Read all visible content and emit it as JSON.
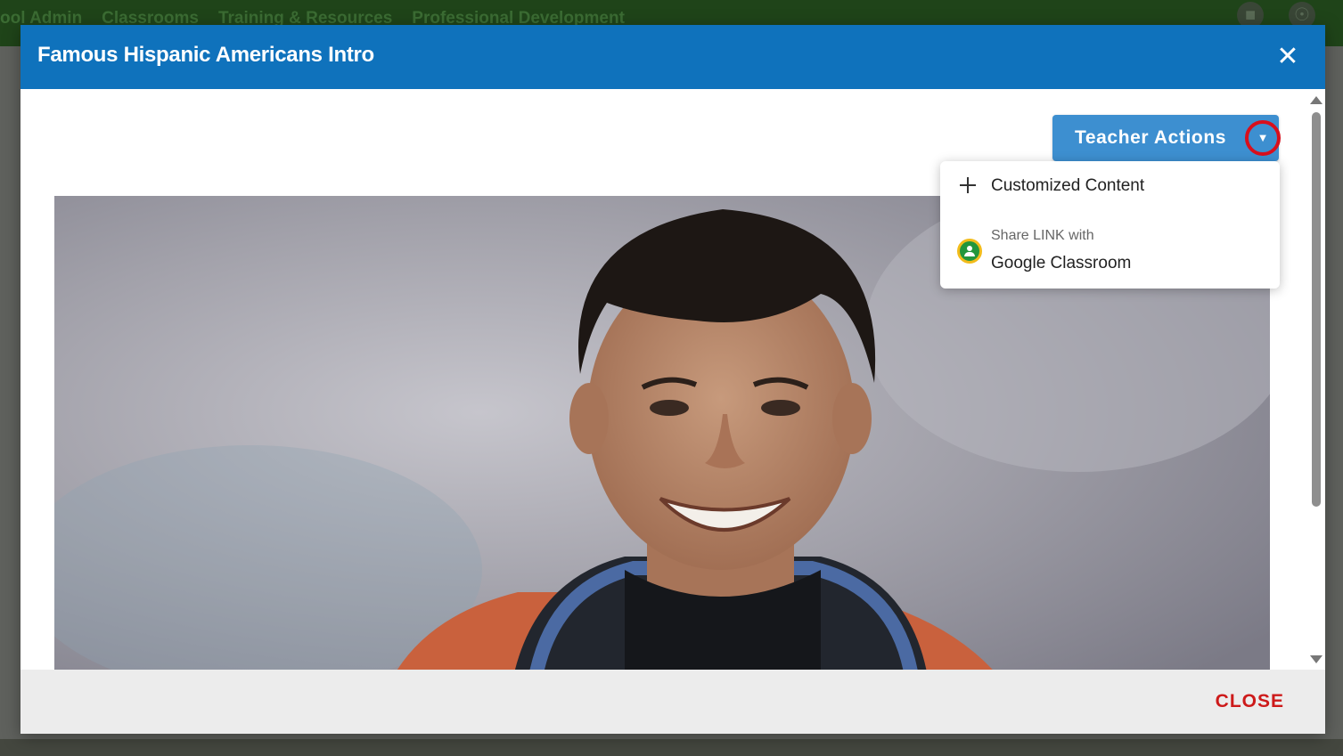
{
  "background": {
    "nav_links": [
      "ool Admin",
      "Classrooms",
      "Training & Resources",
      "Professional Development"
    ]
  },
  "modal": {
    "title": "Famous Hispanic Americans Intro",
    "close_icon": "close-icon",
    "teacher_actions": {
      "label": "Teacher Actions",
      "caret_icon": "caret-down-icon"
    },
    "dropdown": {
      "items": [
        {
          "icon": "plus-icon",
          "label": "Customized Content"
        },
        {
          "icon": "google-classroom-icon",
          "sublabel": "Share LINK with",
          "label": "Google Classroom"
        }
      ]
    },
    "image": {
      "subject": "astronaut-portrait"
    },
    "footer": {
      "close_label": "CLOSE"
    }
  },
  "colors": {
    "header_blue": "#0f72bc",
    "button_blue": "#3d8fd0",
    "highlight_red": "#d90f1c",
    "close_red": "#cd1a1a"
  }
}
